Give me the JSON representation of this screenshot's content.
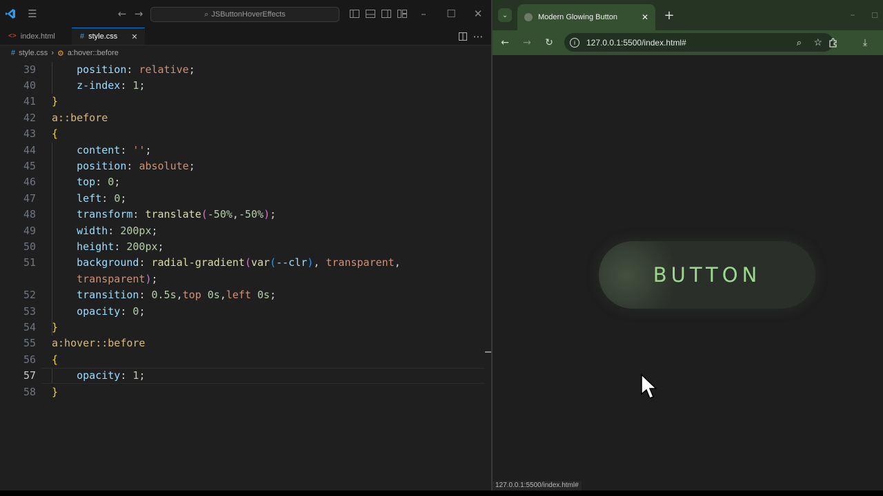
{
  "vscode": {
    "search_text": "JSButtonHoverEffects",
    "tabs": [
      {
        "label": "index.html",
        "icon": "html-file-icon"
      },
      {
        "label": "style.css",
        "icon": "css-file-icon"
      }
    ],
    "breadcrumb": {
      "file": "style.css",
      "symbol": "a:hover::before"
    },
    "code_lines": [
      {
        "n": "39",
        "tokens": [
          [
            "p",
            "    position"
          ],
          [
            "u",
            ": "
          ],
          [
            "v",
            "relative"
          ],
          [
            "u",
            ";"
          ]
        ]
      },
      {
        "n": "40",
        "tokens": [
          [
            "p",
            "    z-index"
          ],
          [
            "u",
            ": "
          ],
          [
            "n",
            "1"
          ],
          [
            "u",
            ";"
          ]
        ]
      },
      {
        "n": "41",
        "tokens": [
          [
            "b",
            "}"
          ]
        ]
      },
      {
        "n": "42",
        "tokens": [
          [
            "s",
            "a::before"
          ]
        ]
      },
      {
        "n": "43",
        "tokens": [
          [
            "b",
            "{"
          ]
        ]
      },
      {
        "n": "44",
        "tokens": [
          [
            "p",
            "    content"
          ],
          [
            "u",
            ": "
          ],
          [
            "v",
            "''"
          ],
          [
            "u",
            ";"
          ]
        ]
      },
      {
        "n": "45",
        "tokens": [
          [
            "p",
            "    position"
          ],
          [
            "u",
            ": "
          ],
          [
            "v",
            "absolute"
          ],
          [
            "u",
            ";"
          ]
        ]
      },
      {
        "n": "46",
        "tokens": [
          [
            "p",
            "    top"
          ],
          [
            "u",
            ": "
          ],
          [
            "n",
            "0"
          ],
          [
            "u",
            ";"
          ]
        ]
      },
      {
        "n": "47",
        "tokens": [
          [
            "p",
            "    left"
          ],
          [
            "u",
            ": "
          ],
          [
            "n",
            "0"
          ],
          [
            "u",
            ";"
          ]
        ]
      },
      {
        "n": "48",
        "tokens": [
          [
            "p",
            "    transform"
          ],
          [
            "u",
            ": "
          ],
          [
            "f",
            "translate"
          ],
          [
            "r",
            "("
          ],
          [
            "n",
            "-50%"
          ],
          [
            "u",
            ","
          ],
          [
            "n",
            "-50%"
          ],
          [
            "r",
            ")"
          ],
          [
            "u",
            ";"
          ]
        ]
      },
      {
        "n": "49",
        "tokens": [
          [
            "p",
            "    width"
          ],
          [
            "u",
            ": "
          ],
          [
            "n",
            "200px"
          ],
          [
            "u",
            ";"
          ]
        ]
      },
      {
        "n": "50",
        "tokens": [
          [
            "p",
            "    height"
          ],
          [
            "u",
            ": "
          ],
          [
            "n",
            "200px"
          ],
          [
            "u",
            ";"
          ]
        ]
      },
      {
        "n": "51",
        "tokens": [
          [
            "p",
            "    background"
          ],
          [
            "u",
            ": "
          ],
          [
            "f",
            "radial-gradient"
          ],
          [
            "r",
            "("
          ],
          [
            "f",
            "var"
          ],
          [
            "q",
            "("
          ],
          [
            "p",
            "--clr"
          ],
          [
            "q",
            ")"
          ],
          [
            "u",
            ", "
          ],
          [
            "v",
            "transparent"
          ],
          [
            "u",
            ","
          ]
        ]
      },
      {
        "n": "",
        "tokens": [
          [
            "v",
            "    transparent"
          ],
          [
            "r",
            ")"
          ],
          [
            "u",
            ";"
          ]
        ]
      },
      {
        "n": "52",
        "tokens": [
          [
            "p",
            "    transition"
          ],
          [
            "u",
            ": "
          ],
          [
            "n",
            "0.5s"
          ],
          [
            "u",
            ","
          ],
          [
            "v",
            "top"
          ],
          [
            "u",
            " "
          ],
          [
            "n",
            "0s"
          ],
          [
            "u",
            ","
          ],
          [
            "v",
            "left"
          ],
          [
            "u",
            " "
          ],
          [
            "n",
            "0s"
          ],
          [
            "u",
            ";"
          ]
        ]
      },
      {
        "n": "53",
        "tokens": [
          [
            "p",
            "    opacity"
          ],
          [
            "u",
            ": "
          ],
          [
            "n",
            "0"
          ],
          [
            "u",
            ";"
          ]
        ]
      },
      {
        "n": "54",
        "tokens": [
          [
            "b",
            "}"
          ]
        ]
      },
      {
        "n": "55",
        "tokens": [
          [
            "s",
            "a:hover::before"
          ]
        ]
      },
      {
        "n": "56",
        "tokens": [
          [
            "b",
            "{"
          ]
        ]
      },
      {
        "n": "57",
        "active": true,
        "tokens": [
          [
            "p",
            "    opacity"
          ],
          [
            "u",
            ": "
          ],
          [
            "n",
            "1"
          ],
          [
            "u",
            ";"
          ]
        ]
      },
      {
        "n": "58",
        "tokens": [
          [
            "b",
            "}"
          ]
        ]
      }
    ]
  },
  "browser": {
    "tab_title": "Modern Glowing Button",
    "url": "127.0.0.1:5500/index.html#",
    "button_label": "BUTTON",
    "status_url": "127.0.0.1:5500/index.html#"
  },
  "colors": {
    "accent": "#0078d4",
    "chrome_frame": "#355031",
    "button_text": "#9cd98f"
  }
}
